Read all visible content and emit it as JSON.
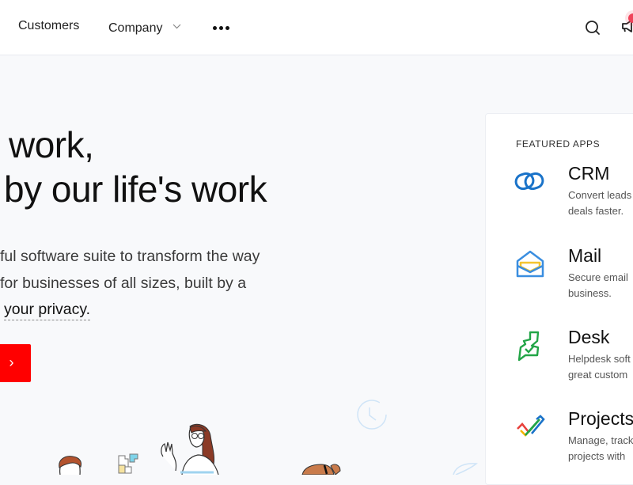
{
  "nav": {
    "items": [
      {
        "label": "Customers"
      },
      {
        "label": "Company",
        "has_dropdown": true
      }
    ],
    "more_icon": "more-horizontal-icon",
    "search_icon": "search-icon",
    "announcement_icon": "megaphone-icon"
  },
  "hero": {
    "title_lines": [
      "work,",
      "by our life's work"
    ],
    "subtitle_lines": [
      "ful software suite to transform the way",
      "for businesses of all sizes, built by a",
      "your privacy."
    ],
    "cta_icon": "›"
  },
  "featured": {
    "heading": "FEATURED APPS",
    "apps": [
      {
        "name": "CRM",
        "desc_lines": [
          "Convert leads",
          "deals faster."
        ],
        "icon": "crm-icon"
      },
      {
        "name": "Mail",
        "desc_lines": [
          "Secure email",
          "business."
        ],
        "icon": "mail-icon"
      },
      {
        "name": "Desk",
        "desc_lines": [
          "Helpdesk soft",
          "great custom"
        ],
        "icon": "desk-icon"
      },
      {
        "name": "Projects",
        "desc_lines": [
          "Manage, track",
          "projects with"
        ],
        "icon": "projects-icon"
      }
    ]
  },
  "colors": {
    "cta": "#ff0000",
    "crm": "#1a73c9",
    "mail_blue": "#3a8ee0",
    "mail_yellow": "#f4c430",
    "desk": "#22a547",
    "notification": "#f0435a"
  }
}
